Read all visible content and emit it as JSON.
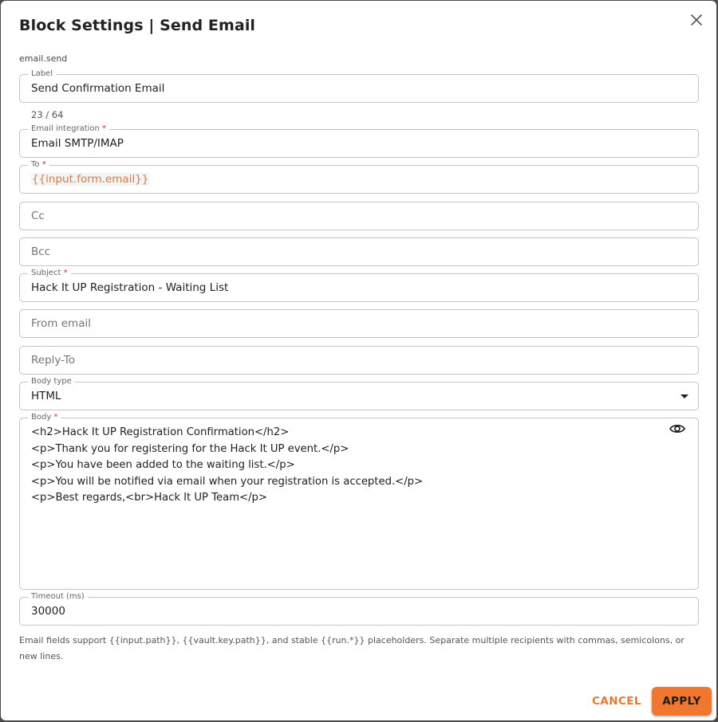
{
  "dialog": {
    "title": "Block Settings | Send Email",
    "block_id": "email.send"
  },
  "fields": {
    "label": {
      "label": "Label",
      "value": "Send Confirmation Email",
      "counter": "23 / 64"
    },
    "integration": {
      "label": "Email integration",
      "required": "*",
      "value": "Email SMTP/IMAP"
    },
    "to": {
      "label": "To",
      "required": "*",
      "value": "{{input.form.email}}"
    },
    "cc": {
      "placeholder": "Cc"
    },
    "bcc": {
      "placeholder": "Bcc"
    },
    "subject": {
      "label": "Subject",
      "required": "*",
      "value": "Hack It UP Registration - Waiting List"
    },
    "from_email": {
      "placeholder": "From email"
    },
    "reply_to": {
      "placeholder": "Reply-To"
    },
    "body_type": {
      "label": "Body type",
      "value": "HTML"
    },
    "body": {
      "label": "Body",
      "required": "*",
      "lines": [
        "<h2>Hack It UP Registration Confirmation</h2>",
        "<p>Thank you for registering for the Hack It UP event.</p>",
        "<p>You have been added to the waiting list.</p>",
        "<p>You will be notified via email when your registration is accepted.</p>",
        "<p>Best regards,<br>Hack It UP Team</p>"
      ]
    },
    "timeout": {
      "label": "Timeout (ms)",
      "value": "30000"
    }
  },
  "help_text": "Email fields support {{input.path}}, {{vault.key.path}}, and stable {{run.*}} placeholders. Separate multiple recipients with commas, semicolons, or new lines.",
  "buttons": {
    "cancel": "CANCEL",
    "apply": "APPLY"
  },
  "icons": {
    "close": "close-icon",
    "preview": "eye-icon",
    "dropdown": "dropdown-arrow-icon"
  },
  "colors": {
    "accent": "#f0782e",
    "token": "#e8792d",
    "required": "#d32f2f"
  }
}
